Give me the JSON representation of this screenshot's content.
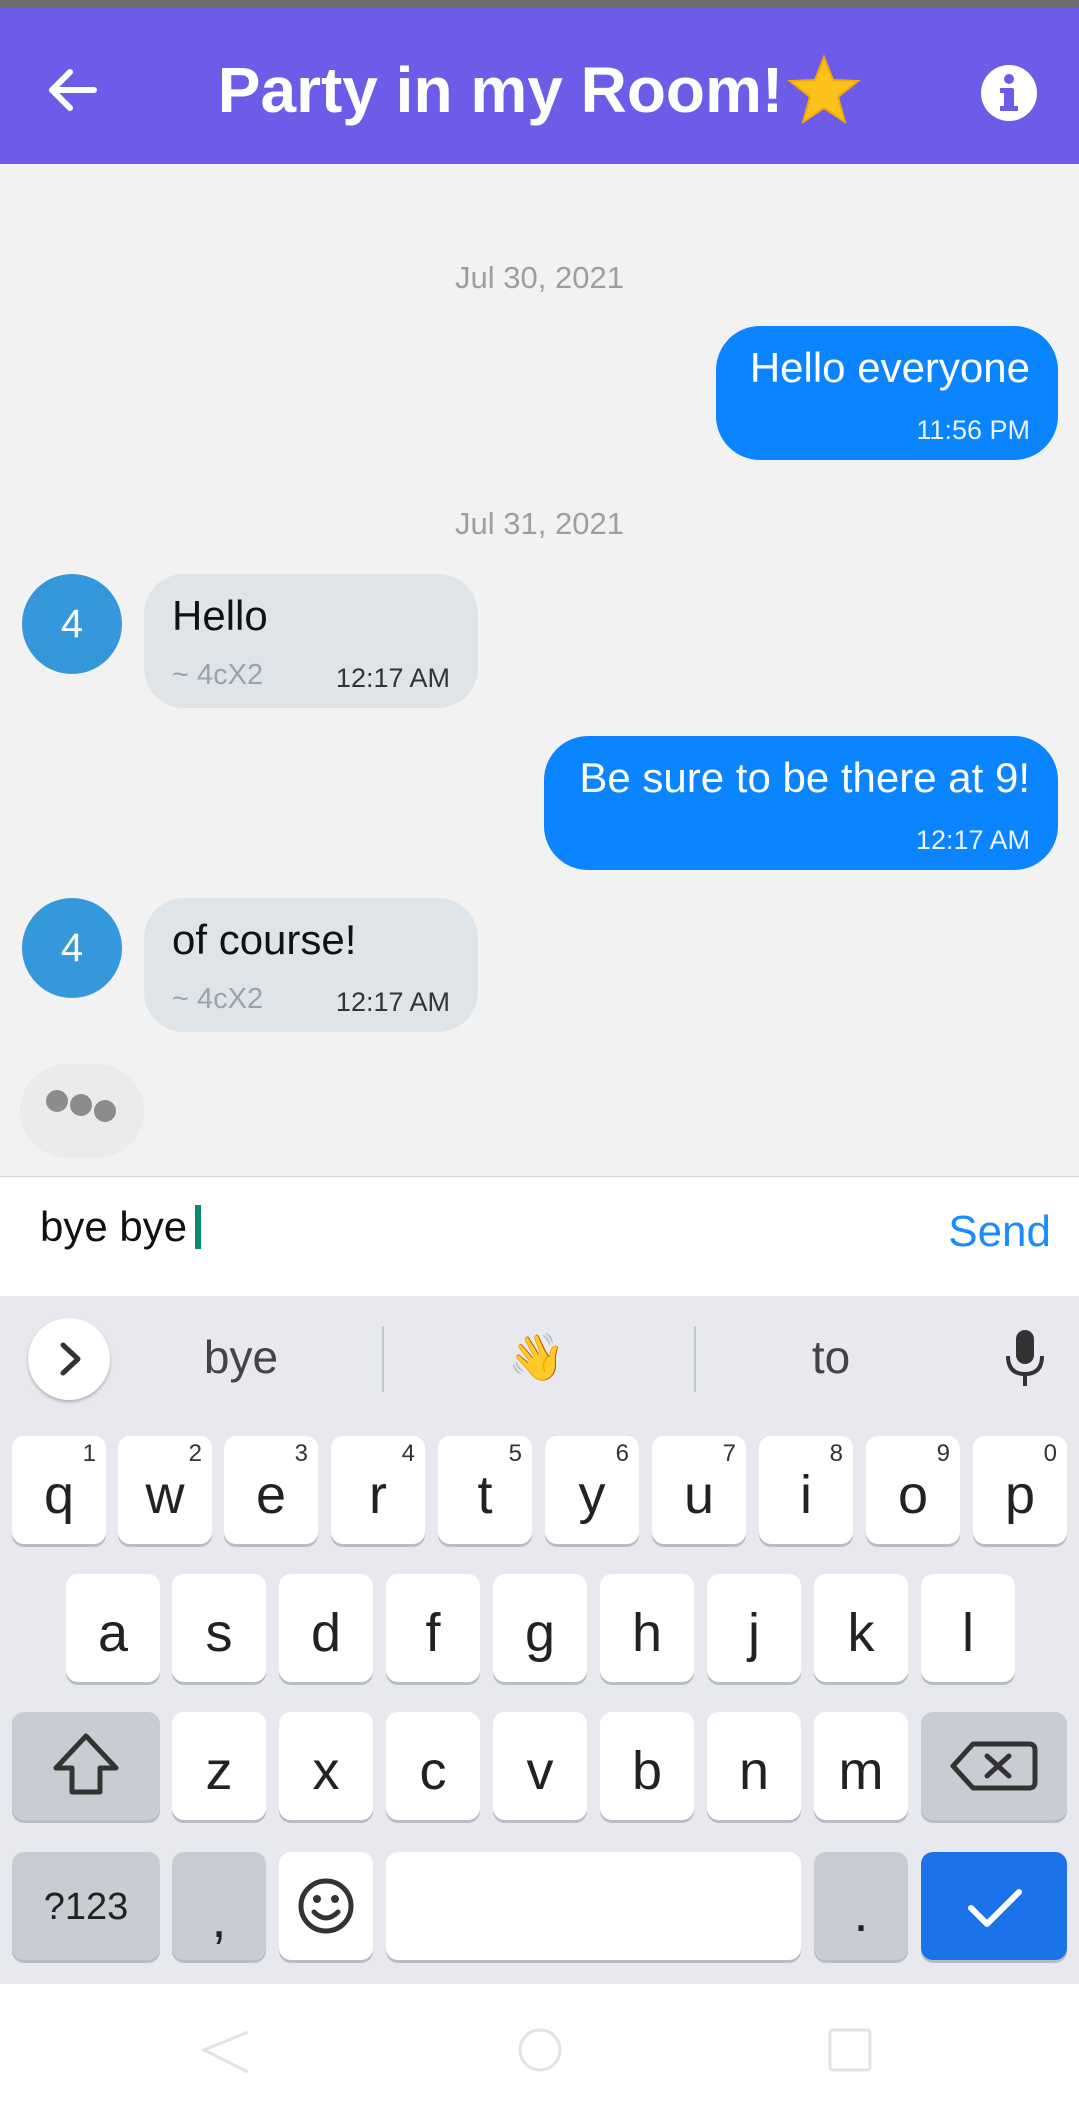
{
  "header": {
    "title": "Party in my Room!",
    "back_icon": "arrow-left-icon",
    "info_icon": "info-circle-icon",
    "star_icon": "star-emoji-icon",
    "color": "#6c5ce7"
  },
  "messages": {
    "date1": "Jul 30, 2021",
    "m1": {
      "text": "Hello everyone",
      "time": "11:56 PM"
    },
    "date2": "Jul 31, 2021",
    "m2": {
      "avatar": "4",
      "text": "Hello",
      "sender": "~ 4cX2",
      "time": "12:17 AM"
    },
    "m3": {
      "text": "Be sure to be there at 9!",
      "time": "12:17 AM"
    },
    "m4": {
      "avatar": "4",
      "text": "of course!",
      "sender": "~ 4cX2",
      "time": "12:17 AM"
    }
  },
  "composer": {
    "value": "bye bye",
    "send_label": "Send"
  },
  "keyboard": {
    "suggestions": [
      "bye",
      "👋",
      "to"
    ],
    "row1": [
      {
        "k": "q",
        "n": "1"
      },
      {
        "k": "w",
        "n": "2"
      },
      {
        "k": "e",
        "n": "3"
      },
      {
        "k": "r",
        "n": "4"
      },
      {
        "k": "t",
        "n": "5"
      },
      {
        "k": "y",
        "n": "6"
      },
      {
        "k": "u",
        "n": "7"
      },
      {
        "k": "i",
        "n": "8"
      },
      {
        "k": "o",
        "n": "9"
      },
      {
        "k": "p",
        "n": "0"
      }
    ],
    "row2": [
      "a",
      "s",
      "d",
      "f",
      "g",
      "h",
      "j",
      "k",
      "l"
    ],
    "row3": [
      "z",
      "x",
      "c",
      "v",
      "b",
      "n",
      "m"
    ],
    "symbols_label": "?123",
    "comma_label": ",",
    "period_label": "."
  }
}
